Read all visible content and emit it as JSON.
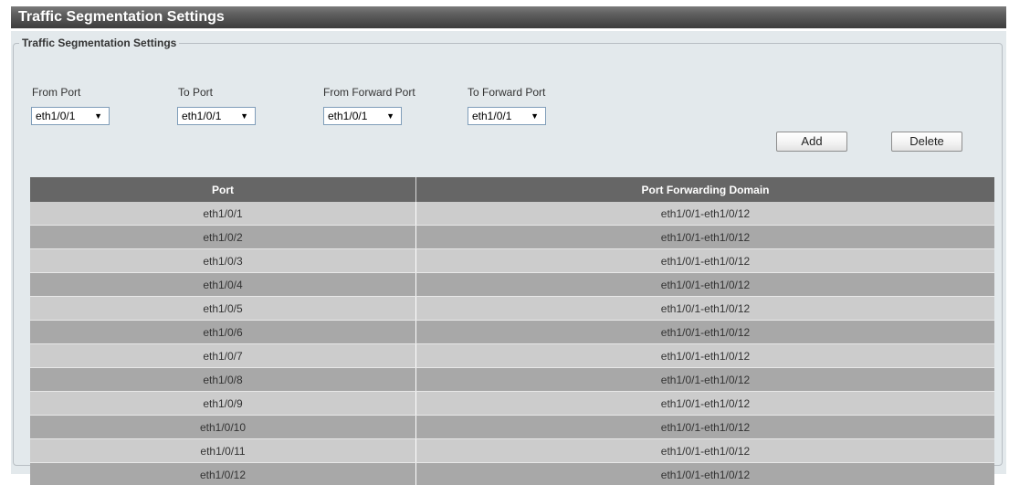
{
  "page": {
    "title": "Traffic Segmentation Settings"
  },
  "settings": {
    "legend": "Traffic Segmentation Settings",
    "from_port": {
      "label": "From Port",
      "value": "eth1/0/1"
    },
    "to_port": {
      "label": "To Port",
      "value": "eth1/0/1"
    },
    "from_forward_port": {
      "label": "From Forward Port",
      "value": "eth1/0/1"
    },
    "to_forward_port": {
      "label": "To Forward Port",
      "value": "eth1/0/1"
    },
    "dropdown_arrow": "▼",
    "add_label": "Add",
    "delete_label": "Delete"
  },
  "table": {
    "headers": [
      "Port",
      "Port Forwarding Domain"
    ],
    "rows": [
      [
        "eth1/0/1",
        "eth1/0/1-eth1/0/12"
      ],
      [
        "eth1/0/2",
        "eth1/0/1-eth1/0/12"
      ],
      [
        "eth1/0/3",
        "eth1/0/1-eth1/0/12"
      ],
      [
        "eth1/0/4",
        "eth1/0/1-eth1/0/12"
      ],
      [
        "eth1/0/5",
        "eth1/0/1-eth1/0/12"
      ],
      [
        "eth1/0/6",
        "eth1/0/1-eth1/0/12"
      ],
      [
        "eth1/0/7",
        "eth1/0/1-eth1/0/12"
      ],
      [
        "eth1/0/8",
        "eth1/0/1-eth1/0/12"
      ],
      [
        "eth1/0/9",
        "eth1/0/1-eth1/0/12"
      ],
      [
        "eth1/0/10",
        "eth1/0/1-eth1/0/12"
      ],
      [
        "eth1/0/11",
        "eth1/0/1-eth1/0/12"
      ],
      [
        "eth1/0/12",
        "eth1/0/1-eth1/0/12"
      ]
    ]
  },
  "colors": {
    "header_bar": "#3c3c3c",
    "panel_background": "#e3e9ec",
    "table_header": "#666666",
    "row_light": "#cccccc",
    "row_dark": "#a8a8a8"
  }
}
